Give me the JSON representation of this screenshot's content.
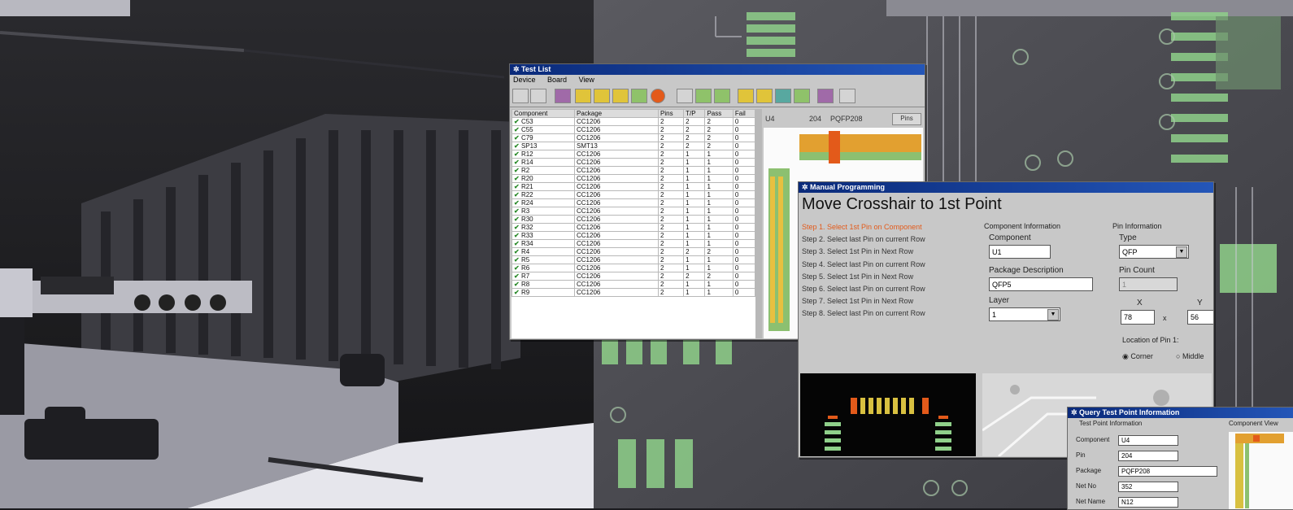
{
  "test_list": {
    "title": "Test List",
    "menu": [
      "Device",
      "Board",
      "View"
    ],
    "columns": [
      "Component",
      "Package",
      "Pins",
      "T/P",
      "Pass",
      "Fail"
    ],
    "rows": [
      [
        "C53",
        "CC1206",
        "2",
        "2",
        "2",
        "0"
      ],
      [
        "C55",
        "CC1206",
        "2",
        "2",
        "2",
        "0"
      ],
      [
        "C79",
        "CC1206",
        "2",
        "2",
        "2",
        "0"
      ],
      [
        "SP13",
        "SMT13",
        "2",
        "2",
        "2",
        "0"
      ],
      [
        "R12",
        "CC1206",
        "2",
        "1",
        "1",
        "0"
      ],
      [
        "R14",
        "CC1206",
        "2",
        "1",
        "1",
        "0"
      ],
      [
        "R2",
        "CC1206",
        "2",
        "1",
        "1",
        "0"
      ],
      [
        "R20",
        "CC1206",
        "2",
        "1",
        "1",
        "0"
      ],
      [
        "R21",
        "CC1206",
        "2",
        "1",
        "1",
        "0"
      ],
      [
        "R22",
        "CC1206",
        "2",
        "1",
        "1",
        "0"
      ],
      [
        "R24",
        "CC1206",
        "2",
        "1",
        "1",
        "0"
      ],
      [
        "R3",
        "CC1206",
        "2",
        "1",
        "1",
        "0"
      ],
      [
        "R30",
        "CC1206",
        "2",
        "1",
        "1",
        "0"
      ],
      [
        "R32",
        "CC1206",
        "2",
        "1",
        "1",
        "0"
      ],
      [
        "R33",
        "CC1206",
        "2",
        "1",
        "1",
        "0"
      ],
      [
        "R34",
        "CC1206",
        "2",
        "1",
        "1",
        "0"
      ],
      [
        "R4",
        "CC1206",
        "2",
        "2",
        "2",
        "0"
      ],
      [
        "R5",
        "CC1206",
        "2",
        "1",
        "1",
        "0"
      ],
      [
        "R6",
        "CC1206",
        "2",
        "1",
        "1",
        "0"
      ],
      [
        "R7",
        "CC1206",
        "2",
        "2",
        "2",
        "0"
      ],
      [
        "R8",
        "CC1206",
        "2",
        "1",
        "1",
        "0"
      ],
      [
        "R9",
        "CC1206",
        "2",
        "1",
        "1",
        "0"
      ]
    ],
    "info_bar": {
      "component": "U4",
      "pins": "204",
      "package": "PQFP208",
      "button": "Pins"
    }
  },
  "manual_programming": {
    "title": "Manual Programming",
    "heading": "Move Crosshair to 1st Point",
    "steps": [
      "Step 1.  Select 1st Pin on Component",
      "Step 2.  Select last Pin on current Row",
      "Step 3.  Select 1st Pin in Next Row",
      "Step 4.  Select last Pin on current Row",
      "Step 5.  Select 1st Pin in Next Row",
      "Step 6.  Select last Pin on current Row",
      "Step 7.  Select 1st Pin in Next Row",
      "Step 8.  Select last Pin on current Row"
    ],
    "component_info": {
      "section": "Component Information",
      "component_label": "Component",
      "component_value": "U1",
      "package_label": "Package Description",
      "package_value": "QFP5",
      "layer_label": "Layer",
      "layer_value": "1"
    },
    "pin_info": {
      "section": "Pin Information",
      "type_label": "Type",
      "type_value": "QFP",
      "count_label": "Pin Count",
      "count_value": "1",
      "x_label": "X",
      "x_value": "78",
      "y_label": "Y",
      "y_value": "56",
      "location_label": "Location of Pin 1:",
      "corner_label": "Corner",
      "middle_label": "Middle"
    }
  },
  "query": {
    "title": "Query Test Point Information",
    "section": "Test Point Information",
    "view_label": "Component View",
    "fields": [
      {
        "label": "Component",
        "value": "U4"
      },
      {
        "label": "Pin",
        "value": "204"
      },
      {
        "label": "Package",
        "value": "PQFP208"
      },
      {
        "label": "Net No",
        "value": "352"
      },
      {
        "label": "Net Name",
        "value": "N12"
      }
    ]
  },
  "colors": {
    "accent": "#e35a1a",
    "title_bar": "#0a2a7a",
    "pad_green": "#8fd08a"
  }
}
